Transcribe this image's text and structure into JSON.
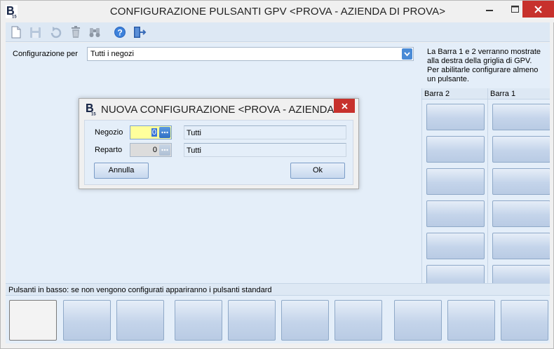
{
  "window": {
    "title": "CONFIGURAZIONE PULSANTI GPV <PROVA - AZIENDA DI PROVA>",
    "logo_text": "B15"
  },
  "toolbar": {
    "icons": [
      "new-document-icon",
      "save-icon",
      "undo-icon",
      "delete-icon",
      "binoculars-icon",
      "help-icon",
      "exit-door-icon"
    ]
  },
  "config": {
    "label": "Configurazione per",
    "value": "Tutti i negozi"
  },
  "info": {
    "text": "La Barra 1 e 2 verranno mostrate alla destra della griglia di GPV. Per abilitarle configurare almeno un pulsante."
  },
  "bars": {
    "bar2_label": "Barra 2",
    "bar1_label": "Barra 1"
  },
  "bottom": {
    "label": "Pulsanti in basso: se non vengono configurati appariranno i pulsanti standard"
  },
  "dialog": {
    "title": "NUOVA CONFIGURAZIONE <PROVA - AZIENDA...",
    "negozio_label": "Negozio",
    "negozio_value": "0",
    "negozio_desc": "Tutti",
    "reparto_label": "Reparto",
    "reparto_value": "0",
    "reparto_desc": "Tutti",
    "cancel_label": "Annulla",
    "ok_label": "Ok"
  },
  "colors": {
    "panel_bg": "#e4eef9",
    "toolbar_bg": "#dde8f4",
    "close_red": "#c7312c",
    "active_field": "#ffff9c"
  }
}
